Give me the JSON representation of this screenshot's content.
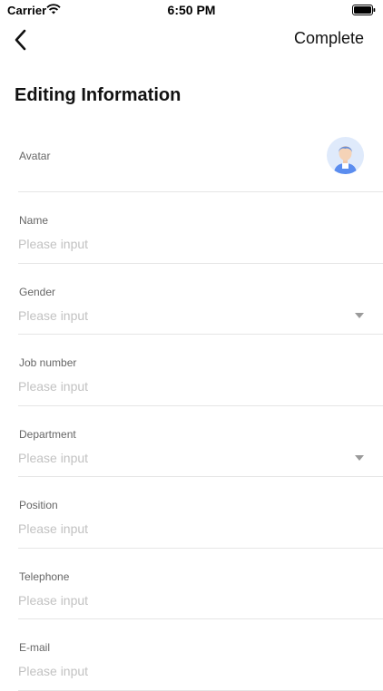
{
  "status": {
    "carrier": "Carrier",
    "time": "6:50 PM"
  },
  "nav": {
    "back_icon": "chevron-left-icon",
    "complete_label": "Complete"
  },
  "page": {
    "title": "Editing Information"
  },
  "form": {
    "avatar_label": "Avatar",
    "avatar_icon": "user-avatar-icon",
    "fields": [
      {
        "label": "Name",
        "placeholder": "Please input",
        "type": "text"
      },
      {
        "label": "Gender",
        "placeholder": "Please input",
        "type": "select"
      },
      {
        "label": "Job number",
        "placeholder": "Please input",
        "type": "text"
      },
      {
        "label": "Department",
        "placeholder": "Please input",
        "type": "select"
      },
      {
        "label": "Position",
        "placeholder": "Please input",
        "type": "text"
      },
      {
        "label": "Telephone",
        "placeholder": "Please input",
        "type": "text"
      },
      {
        "label": "E-mail",
        "placeholder": "Please input",
        "type": "text"
      }
    ]
  },
  "colors": {
    "divider": "#e6e6e6",
    "placeholder": "#c2c2c2",
    "avatar_bg": "#dfeafb",
    "avatar_figure": "#5b8def"
  }
}
